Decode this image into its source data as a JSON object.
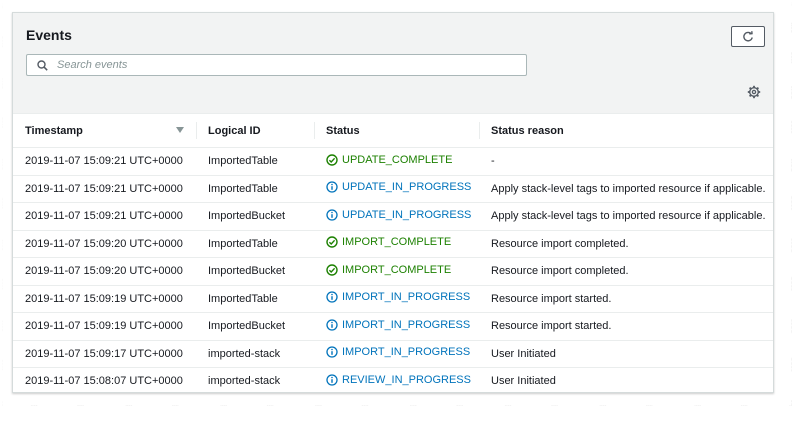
{
  "panel": {
    "title": "Events",
    "search_placeholder": "Search events"
  },
  "colors": {
    "complete": "#1d8102",
    "in_progress": "#0073bb"
  },
  "table": {
    "columns": [
      "Timestamp",
      "Logical ID",
      "Status",
      "Status reason"
    ],
    "sort_column": "Timestamp",
    "rows": [
      {
        "timestamp": "2019-11-07 15:09:21 UTC+0000",
        "logical_id": "ImportedTable",
        "status": "UPDATE_COMPLETE",
        "status_icon": "check-circle-icon",
        "reason": "-"
      },
      {
        "timestamp": "2019-11-07 15:09:21 UTC+0000",
        "logical_id": "ImportedTable",
        "status": "UPDATE_IN_PROGRESS",
        "status_icon": "info-circle-icon",
        "reason": "Apply stack-level tags to imported resource if applicable."
      },
      {
        "timestamp": "2019-11-07 15:09:21 UTC+0000",
        "logical_id": "ImportedBucket",
        "status": "UPDATE_IN_PROGRESS",
        "status_icon": "info-circle-icon",
        "reason": "Apply stack-level tags to imported resource if applicable."
      },
      {
        "timestamp": "2019-11-07 15:09:20 UTC+0000",
        "logical_id": "ImportedTable",
        "status": "IMPORT_COMPLETE",
        "status_icon": "check-circle-icon",
        "reason": "Resource import completed."
      },
      {
        "timestamp": "2019-11-07 15:09:20 UTC+0000",
        "logical_id": "ImportedBucket",
        "status": "IMPORT_COMPLETE",
        "status_icon": "check-circle-icon",
        "reason": "Resource import completed."
      },
      {
        "timestamp": "2019-11-07 15:09:19 UTC+0000",
        "logical_id": "ImportedTable",
        "status": "IMPORT_IN_PROGRESS",
        "status_icon": "info-circle-icon",
        "reason": "Resource import started."
      },
      {
        "timestamp": "2019-11-07 15:09:19 UTC+0000",
        "logical_id": "ImportedBucket",
        "status": "IMPORT_IN_PROGRESS",
        "status_icon": "info-circle-icon",
        "reason": "Resource import started."
      },
      {
        "timestamp": "2019-11-07 15:09:17 UTC+0000",
        "logical_id": "imported-stack",
        "status": "IMPORT_IN_PROGRESS",
        "status_icon": "info-circle-icon",
        "reason": "User Initiated"
      },
      {
        "timestamp": "2019-11-07 15:08:07 UTC+0000",
        "logical_id": "imported-stack",
        "status": "REVIEW_IN_PROGRESS",
        "status_icon": "info-circle-icon",
        "reason": "User Initiated"
      }
    ]
  }
}
